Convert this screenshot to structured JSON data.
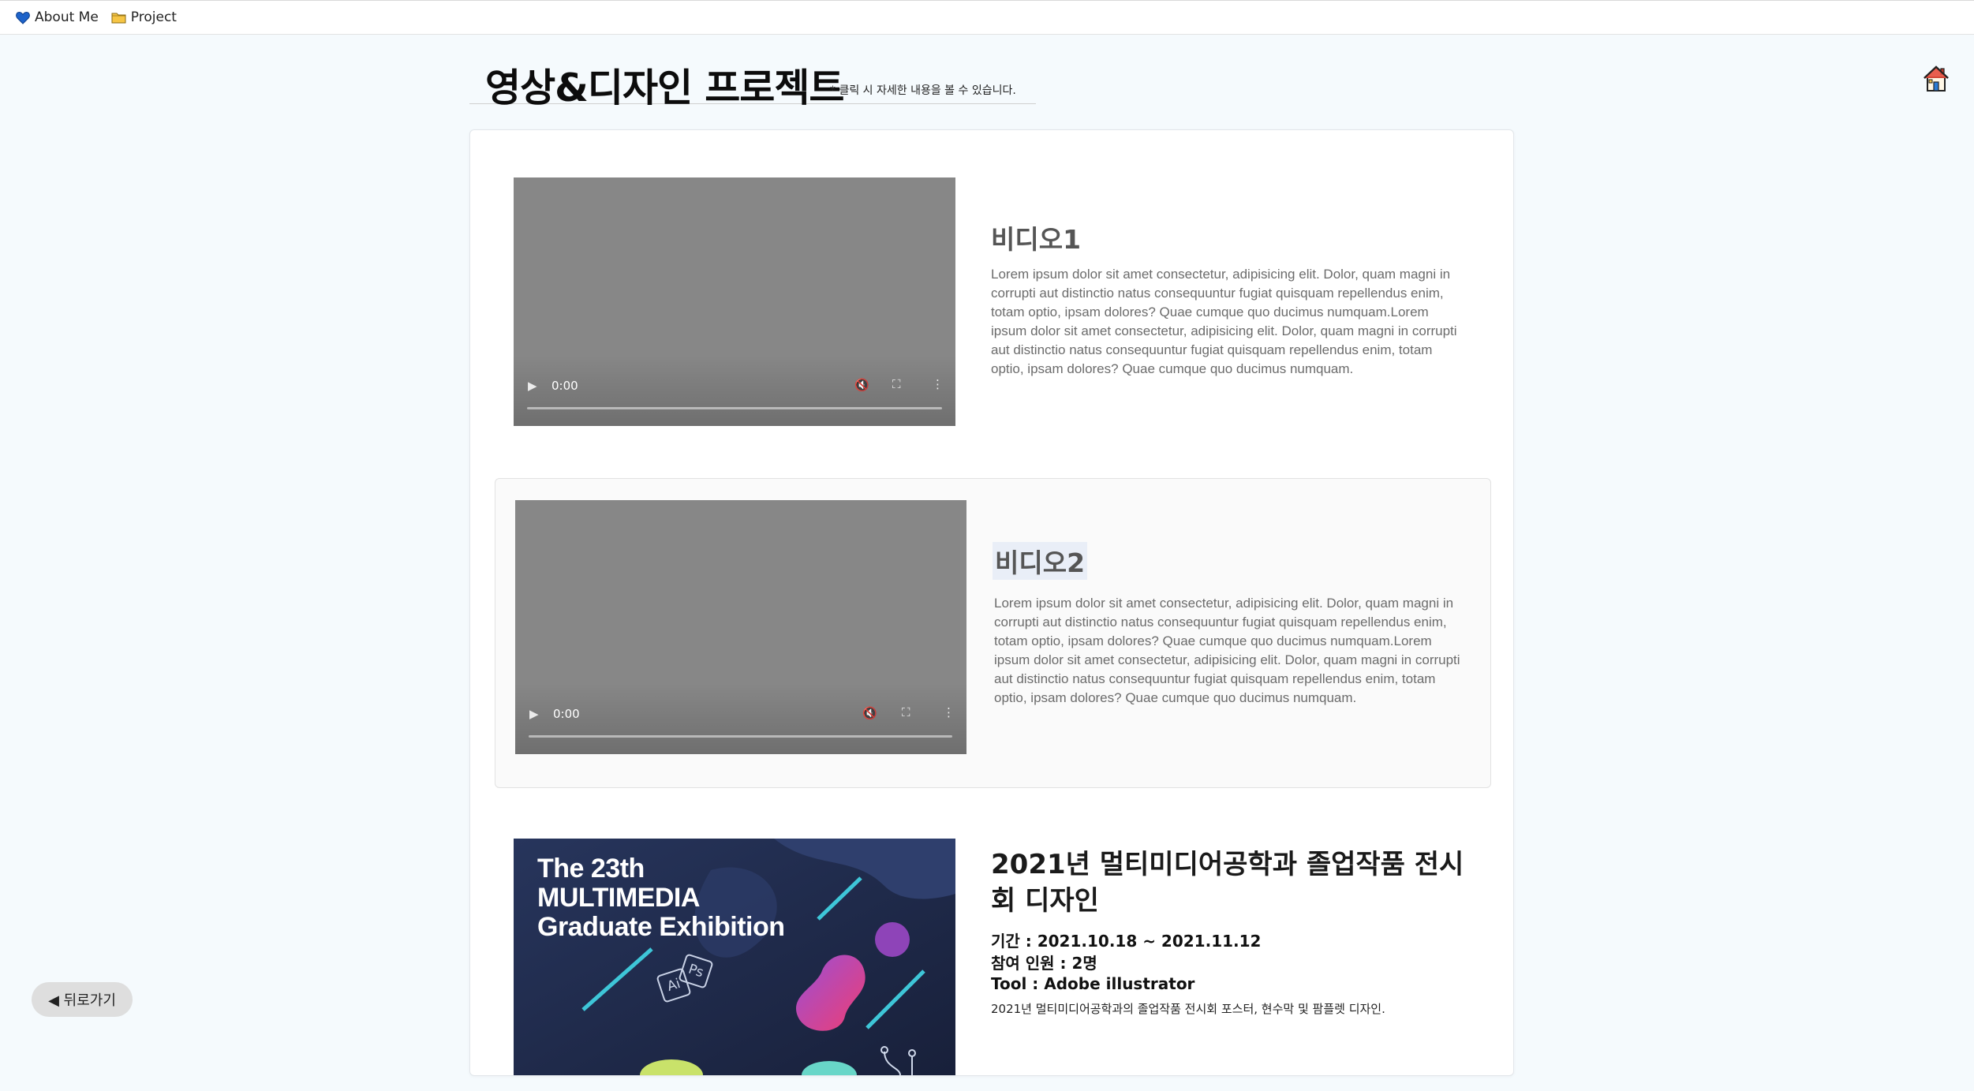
{
  "nav": {
    "about_label": "About Me",
    "project_label": "Project"
  },
  "header": {
    "title": "영상&디자인 프로젝트",
    "note": "* 클릭 시 자세한 내용을 볼 수 있습니다."
  },
  "items": [
    {
      "title": "비디오1",
      "time": "0:00",
      "description": "Lorem ipsum dolor sit amet consectetur, adipisicing elit. Dolor, quam magni in corrupti aut distinctio natus consequuntur fugiat quisquam repellendus enim, totam optio, ipsam dolores? Quae cumque quo ducimus numquam.Lorem ipsum dolor sit amet consectetur, adipisicing elit. Dolor, quam magni in corrupti aut distinctio natus consequuntur fugiat quisquam repellendus enim, totam optio, ipsam dolores? Quae cumque quo ducimus numquam."
    },
    {
      "title": "비디오2",
      "time": "0:00",
      "description": "Lorem ipsum dolor sit amet consectetur, adipisicing elit. Dolor, quam magni in corrupti aut distinctio natus consequuntur fugiat quisquam repellendus enim, totam optio, ipsam dolores? Quae cumque quo ducimus numquam.Lorem ipsum dolor sit amet consectetur, adipisicing elit. Dolor, quam magni in corrupti aut distinctio natus consequuntur fugiat quisquam repellendus enim, totam optio, ipsam dolores? Quae cumque quo ducimus numquam."
    },
    {
      "title": "2021년 멀티미디어공학과 졸업작품 전시회 디자인",
      "period": "기간 : 2021.10.18 ~ 2021.11.12",
      "members": "참여 인원 : 2명",
      "tool": "Tool : Adobe illustrator",
      "description": "2021년 멀티미디어공학과의 졸업작품 전시회 포스터, 현수막 및 팜플렛 디자인.",
      "poster_lines": [
        "The 23th",
        "MULTIMEDIA",
        "Graduate Exhibition"
      ],
      "poster_badges": [
        "Ai",
        "Ps"
      ]
    }
  ],
  "back_label": "◀ 뒤로가기",
  "colors": {
    "page_bg": "#f5fafd",
    "video_bg": "#878787",
    "poster_bg": "#1f2a4a"
  }
}
